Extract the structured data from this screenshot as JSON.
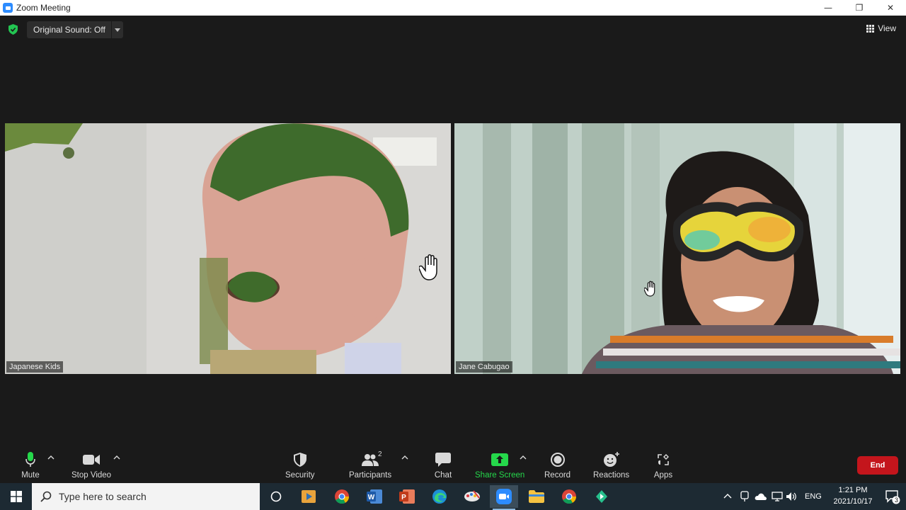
{
  "window": {
    "title": "Zoom Meeting",
    "minimize": "—",
    "restore": "❐",
    "close": "✕"
  },
  "meeting": {
    "original_sound": "Original Sound: Off",
    "view_label": "View",
    "participants": [
      {
        "name": "Japanese Kids"
      },
      {
        "name": "Jane Cabugao"
      }
    ]
  },
  "toolbar": {
    "mute": "Mute",
    "stop_video": "Stop Video",
    "security": "Security",
    "participants": "Participants",
    "participant_count": "2",
    "chat": "Chat",
    "share_screen": "Share Screen",
    "record": "Record",
    "reactions": "Reactions",
    "apps": "Apps",
    "end": "End"
  },
  "taskbar": {
    "search_placeholder": "Type here to search",
    "language": "ENG",
    "time": "1:21 PM",
    "date": "2021/10/17",
    "notification_count": "3"
  },
  "colors": {
    "zoom_blue": "#2d8cff",
    "share_green": "#25d84b",
    "end_red": "#c4151c",
    "background": "#1a1a1a"
  }
}
